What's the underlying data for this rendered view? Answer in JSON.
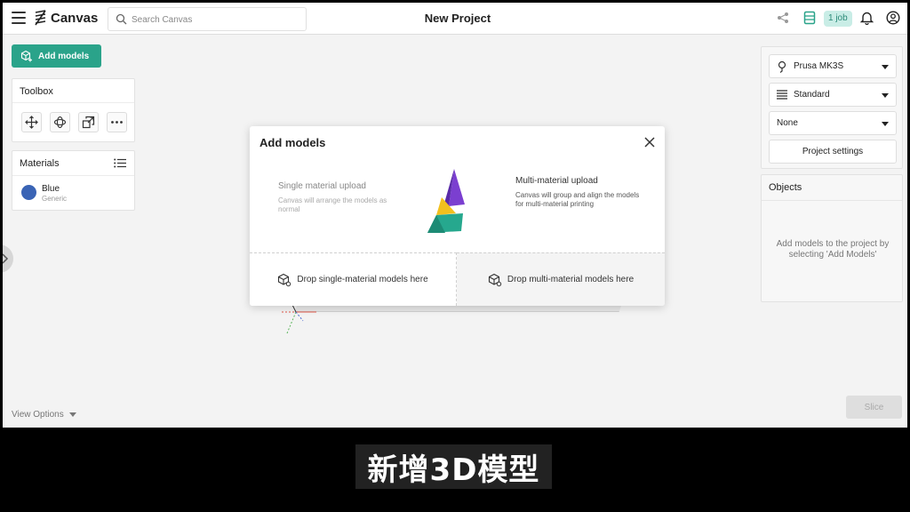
{
  "header": {
    "app_name": "Canvas",
    "search_placeholder": "Search Canvas",
    "project_title": "New Project",
    "job_badge": "1 job"
  },
  "left": {
    "add_models_label": "Add models",
    "toolbox_title": "Toolbox",
    "materials_title": "Materials",
    "material": {
      "name": "Blue",
      "subtitle": "Generic",
      "color": "#3a64b5"
    },
    "view_options_label": "View Options"
  },
  "right": {
    "printer": "Prusa MK3S",
    "profile": "Standard",
    "support": "None",
    "project_settings_label": "Project settings",
    "objects_title": "Objects",
    "objects_hint": "Add models to the project by selecting 'Add Models'",
    "slice_label": "Slice"
  },
  "modal": {
    "title": "Add models",
    "single": {
      "title": "Single material upload",
      "desc": "Canvas will arrange the models as normal",
      "drop_label": "Drop single-material models here"
    },
    "multi": {
      "title": "Multi-material upload",
      "desc": "Canvas will group and align the models for multi-material printing",
      "drop_label": "Drop multi-material models here"
    }
  },
  "subtitle": "新增3D模型",
  "colors": {
    "accent": "#2aa38a",
    "badge_bg": "#c9ede6",
    "logo_purple": "#7b3fd0",
    "logo_yellow": "#f2c01e",
    "logo_teal": "#26a88e"
  }
}
